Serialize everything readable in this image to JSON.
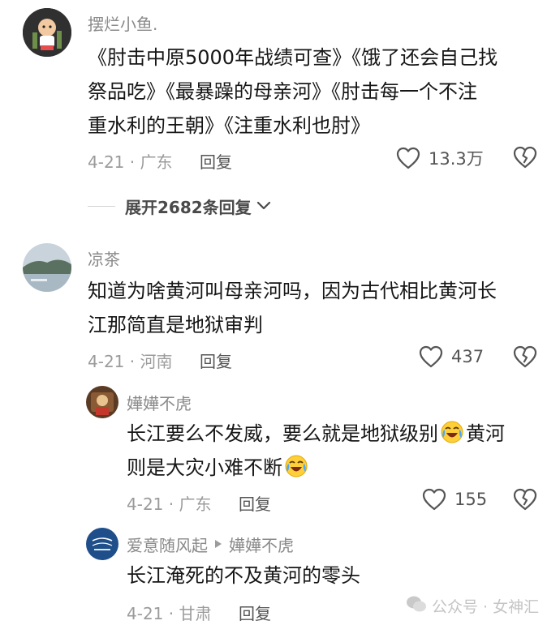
{
  "comments": [
    {
      "username": "摆烂小鱼.",
      "lines": [
        "《肘击中原5000年战绩可查》《饿了还会自己找",
        "祭品吃》《最暴躁的母亲河》《肘击每一个不注",
        "重水利的王朝》《注重水利也肘》"
      ],
      "date_location": "4-21 · 广东",
      "reply_label": "回复",
      "likes": "13.3万"
    },
    {
      "username": "凉茶",
      "lines": [
        "知道为啥黄河叫母亲河吗，因为古代相比黄河长",
        "江那简直是地狱审判"
      ],
      "date_location": "4-21 · 河南",
      "reply_label": "回复",
      "likes": "437"
    }
  ],
  "expand_label": "展开2682条回复",
  "replies": [
    {
      "username": "嬅嬅不虎",
      "line1_a": "长江要么不发威，要么就是地狱级别",
      "line1_b": "黄河",
      "line2_a": "则是大灾小难不断",
      "date_location": "4-21 · 广东",
      "reply_label": "回复",
      "likes": "155"
    },
    {
      "username": "爱意随风起",
      "reply_to": "嬅嬅不虎",
      "lines": [
        "长江淹死的不及黄河的零头"
      ],
      "date_location": "4-21 · 甘肃",
      "reply_label": "回复"
    }
  ],
  "watermark_text": "公众号 · 女神汇",
  "icons": {
    "like": "heart-outline-icon",
    "dislike": "broken-heart-icon",
    "expand": "chevron-down-icon",
    "reply_arrow": "triangle-right-icon",
    "emoji": "laughing-crying-emoji"
  },
  "colors": {
    "username": "#8a8a8a",
    "meta": "#9b9b9b",
    "body": "#161616",
    "avatar2_sky": "#c9d3dc"
  }
}
